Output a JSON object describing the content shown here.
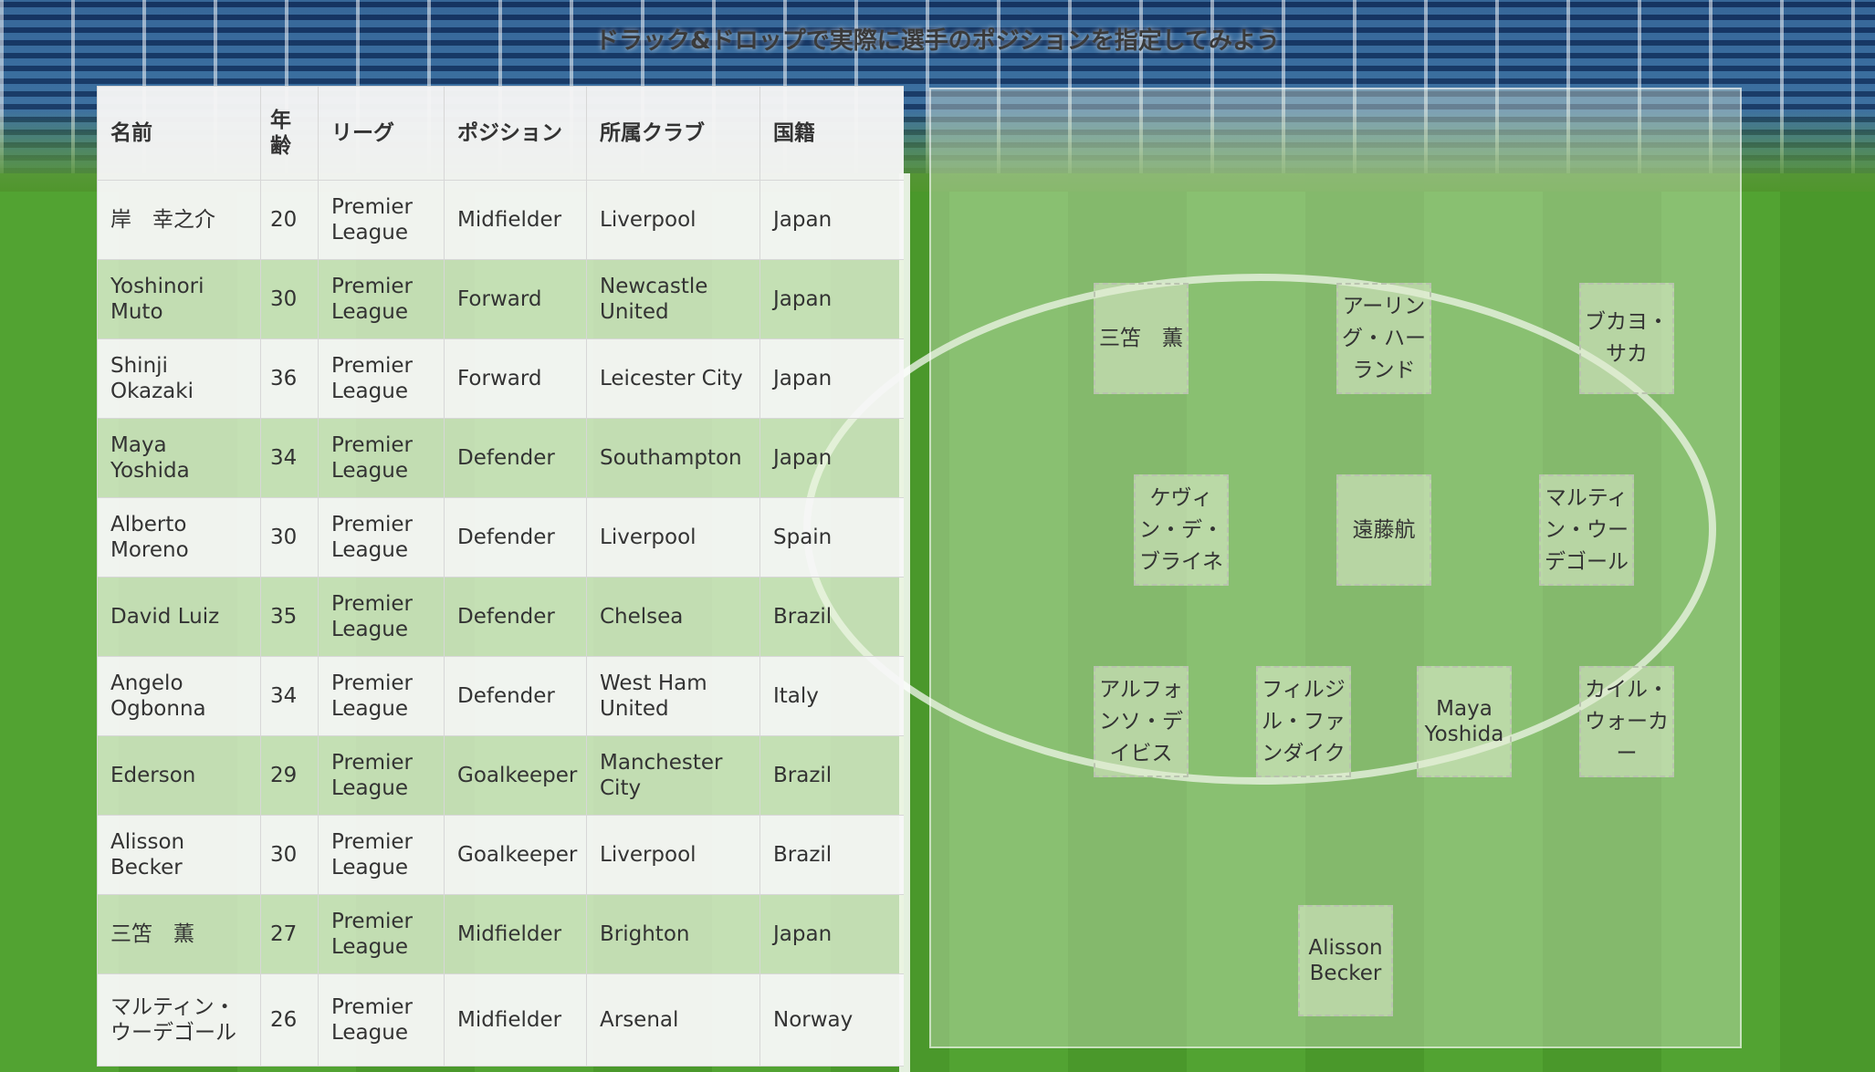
{
  "title": "ドラック&ドロップで実際に選手のポジションを指定してみよう",
  "table": {
    "headers": [
      "名前",
      "年齢",
      "リーグ",
      "ポジション",
      "所属クラブ",
      "国籍"
    ],
    "rows": [
      {
        "name": "岸　幸之介",
        "age": "20",
        "league": "Premier League",
        "position": "Midfielder",
        "club": "Liverpool",
        "nationality": "Japan"
      },
      {
        "name": "Yoshinori Muto",
        "age": "30",
        "league": "Premier League",
        "position": "Forward",
        "club": "Newcastle United",
        "nationality": "Japan"
      },
      {
        "name": "Shinji Okazaki",
        "age": "36",
        "league": "Premier League",
        "position": "Forward",
        "club": "Leicester City",
        "nationality": "Japan"
      },
      {
        "name": "Maya Yoshida",
        "age": "34",
        "league": "Premier League",
        "position": "Defender",
        "club": "Southampton",
        "nationality": "Japan"
      },
      {
        "name": "Alberto Moreno",
        "age": "30",
        "league": "Premier League",
        "position": "Defender",
        "club": "Liverpool",
        "nationality": "Spain"
      },
      {
        "name": "David Luiz",
        "age": "35",
        "league": "Premier League",
        "position": "Defender",
        "club": "Chelsea",
        "nationality": "Brazil"
      },
      {
        "name": "Angelo Ogbonna",
        "age": "34",
        "league": "Premier League",
        "position": "Defender",
        "club": "West Ham United",
        "nationality": "Italy"
      },
      {
        "name": "Ederson",
        "age": "29",
        "league": "Premier League",
        "position": "Goalkeeper",
        "club": "Manchester City",
        "nationality": "Brazil"
      },
      {
        "name": "Alisson Becker",
        "age": "30",
        "league": "Premier League",
        "position": "Goalkeeper",
        "club": "Liverpool",
        "nationality": "Brazil"
      },
      {
        "name": "三笘　薫",
        "age": "27",
        "league": "Premier League",
        "position": "Midfielder",
        "club": "Brighton",
        "nationality": "Japan"
      },
      {
        "name": "マルティン・ウーデゴール",
        "age": "26",
        "league": "Premier League",
        "position": "Midfielder",
        "club": "Arsenal",
        "nationality": "Norway"
      }
    ]
  },
  "formation": {
    "players": [
      {
        "id": "mitoma",
        "label": "三笘　薫"
      },
      {
        "id": "haaland",
        "label": "アーリング・ハーランド"
      },
      {
        "id": "saka",
        "label": "ブカヨ・サカ"
      },
      {
        "id": "debruyne",
        "label": "ケヴィン・デ・ブライネ"
      },
      {
        "id": "endo",
        "label": "遠藤航"
      },
      {
        "id": "odegaard",
        "label": "マルティン・ウーデゴール"
      },
      {
        "id": "davies",
        "label": "アルフォンソ・デイビス"
      },
      {
        "id": "vandijk",
        "label": "フィルジル・ファンダイク"
      },
      {
        "id": "yoshida",
        "label": "Maya Yoshida"
      },
      {
        "id": "walker",
        "label": "カイル・ウォーカー"
      },
      {
        "id": "alisson",
        "label": "Alisson Becker"
      }
    ]
  }
}
